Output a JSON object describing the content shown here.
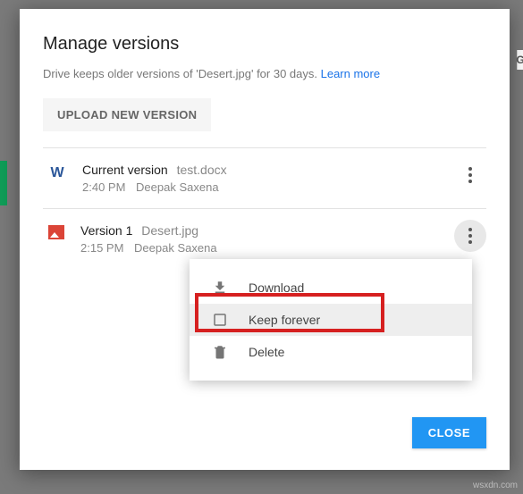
{
  "modal": {
    "title": "Manage versions",
    "subtitle_prefix": "Drive keeps older versions of 'Desert.jpg' for 30 days. ",
    "learn_more": "Learn more",
    "upload_button": "UPLOAD NEW VERSION",
    "close_button": "CLOSE"
  },
  "versions": [
    {
      "label": "Current version",
      "filename": "test.docx",
      "time": "2:40 PM",
      "author": "Deepak Saxena"
    },
    {
      "label": "Version 1",
      "filename": "Desert.jpg",
      "time": "2:15 PM",
      "author": "Deepak Saxena"
    }
  ],
  "menu": {
    "download": "Download",
    "keep_forever": "Keep forever",
    "delete": "Delete"
  },
  "watermark": "wsxdn.com"
}
